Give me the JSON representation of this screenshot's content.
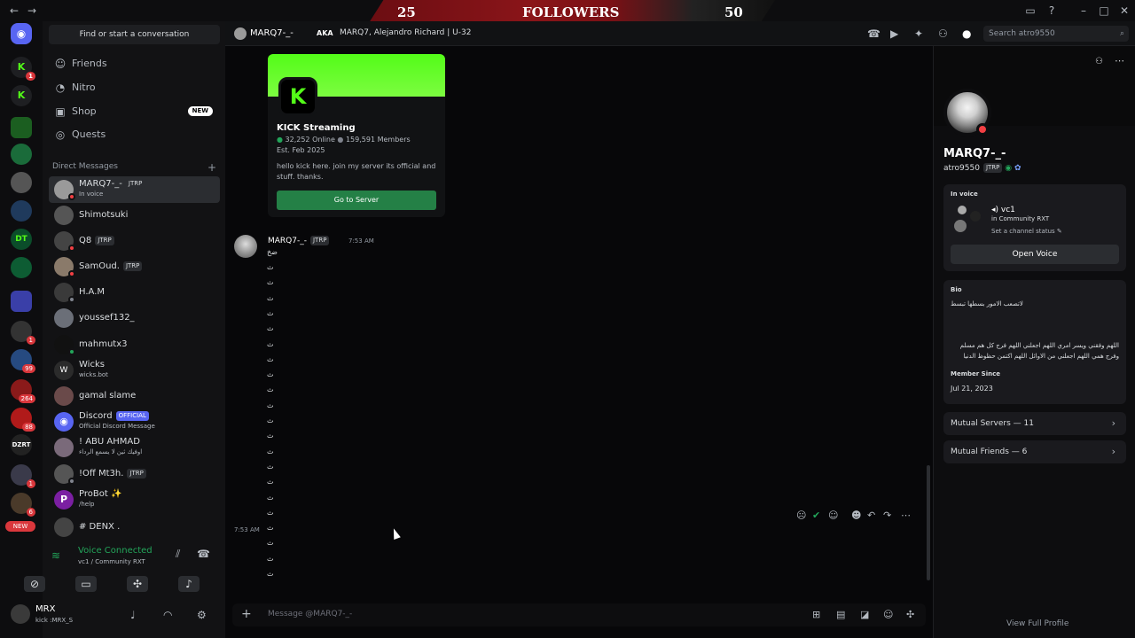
{
  "followers_banner": {
    "left": "25",
    "label": "FOLLOWERS",
    "right": "50"
  },
  "rail": {
    "badges": [
      "1",
      "1",
      "99",
      "264",
      "88",
      "1",
      "6"
    ],
    "new_label": "NEW"
  },
  "sidebar": {
    "search_label": "Find or start a conversation",
    "nav": [
      {
        "label": "Friends",
        "icon": "friends-icon"
      },
      {
        "label": "Nitro",
        "icon": "nitro-icon"
      },
      {
        "label": "Shop",
        "icon": "shop-icon",
        "badge": "NEW"
      },
      {
        "label": "Quests",
        "icon": "quests-icon"
      }
    ],
    "dm_heading": "Direct Messages",
    "dms": [
      {
        "name": "MARQ7-_-",
        "tag": "JTRP",
        "sub": "In voice"
      },
      {
        "name": "Shimotsuki"
      },
      {
        "name": "Q8",
        "tag": "JTRP"
      },
      {
        "name": "SamOud.",
        "tag": "JTRP"
      },
      {
        "name": "H.A.M"
      },
      {
        "name": "youssef132_"
      },
      {
        "name": "mahmutx3"
      },
      {
        "name": "Wicks",
        "sub": "wicks.bot"
      },
      {
        "name": "gamal slame"
      },
      {
        "name": "Discord",
        "tag": "OFFICIAL",
        "sub": "Official Discord Message"
      },
      {
        "name": "! ABU AHMAD",
        "sub": "اوفيك ثين لا يسمع الرداء"
      },
      {
        "name": "!Off Mt3h.",
        "tag": "JTRP"
      },
      {
        "name": "ProBot ✨",
        "sub": "/help"
      },
      {
        "name": "# DENX ."
      }
    ]
  },
  "voice": {
    "status": "Voice Connected",
    "channel": "vc1 / Community RXT"
  },
  "user": {
    "name": "MRX",
    "status": "kick :MRX_S"
  },
  "header": {
    "name": "MARQ7-_-",
    "aka": "AKA",
    "aliases": "MARQ7, Alejandro Richard | U-32",
    "search_placeholder": "Search atro9550"
  },
  "invite": {
    "server": "KICK Streaming",
    "online": "32,252 Online",
    "members": "159,591 Members",
    "est": "Est. Feb 2025",
    "description": "hello kick here. join my server its official and stuff. thanks.",
    "button": "Go to Server"
  },
  "message": {
    "author": "MARQ7-_-",
    "tag": "JTRP",
    "time": "7:53 AM",
    "first_line": "ضخ",
    "repeat_char": "ث",
    "hover_time": "7:53 AM"
  },
  "composer": {
    "placeholder": "Message @MARQ7-_-"
  },
  "profile": {
    "display_name": "MARQ7-_-",
    "username": "atro9550",
    "tag": "JTRP",
    "in_voice_heading": "In voice",
    "voice_channel": "vc1",
    "voice_server": "in Community RXT",
    "channel_status": "Set a channel status",
    "open_voice": "Open Voice",
    "bio_heading": "Bio",
    "bio_line1": "لاتصعب الامور بسطها تبسط",
    "bio_line2": "اللهم وفقني ويسر امري اللهم اجعلني اللهم فرج كل هم مسلم",
    "bio_line3": "وفرج همي اللهم اجعلني من الاوائل اللهم اكتمن حظوظ الدنيا",
    "member_since_heading": "Member Since",
    "member_since": "Jul 21, 2023",
    "mutual_servers": "Mutual Servers — 11",
    "mutual_friends": "Mutual Friends — 6",
    "view_full": "View Full Profile"
  },
  "colors": {
    "accent": "#5865f2",
    "kick_green": "#53fc18",
    "online": "#23a55a",
    "dnd": "#f23f43"
  }
}
